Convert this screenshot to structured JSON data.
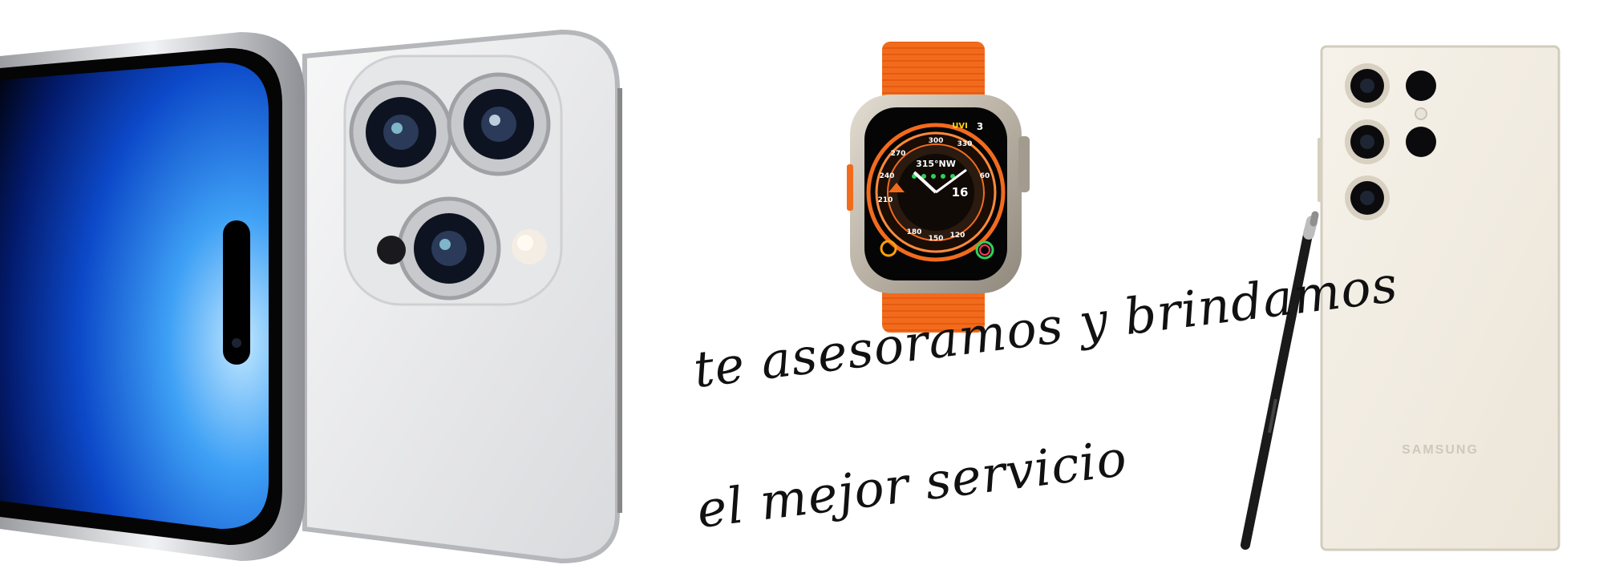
{
  "tagline": {
    "line1": "te asesoramos y brindamos",
    "line2": "el mejor servicio"
  },
  "watch_face": {
    "heading": "315°NW",
    "date": "16",
    "compass_top": "300",
    "compass_right": "330",
    "compass_left_a": "270",
    "compass_left_b": "240",
    "compass_left_c": "210",
    "compass_bottom": "150",
    "compass_bottom_b": "180",
    "complication_top": "UVI",
    "complication_num": "3",
    "compass_right_b": "60",
    "compass_right_c": "120"
  },
  "samsung_phone": {
    "brand_label": "SAMSUNG"
  },
  "colors": {
    "watch_band": "#f26b1d",
    "watch_accent": "#ff6a13",
    "iphone_screen": "#1e6fe0",
    "iphone_body": "#e9eaec",
    "samsung_body": "#f2ede4",
    "text": "#111111"
  },
  "icons": [
    "iphone-camera-icon",
    "apple-watch-icon",
    "s-pen-icon",
    "samsung-camera-icon"
  ]
}
